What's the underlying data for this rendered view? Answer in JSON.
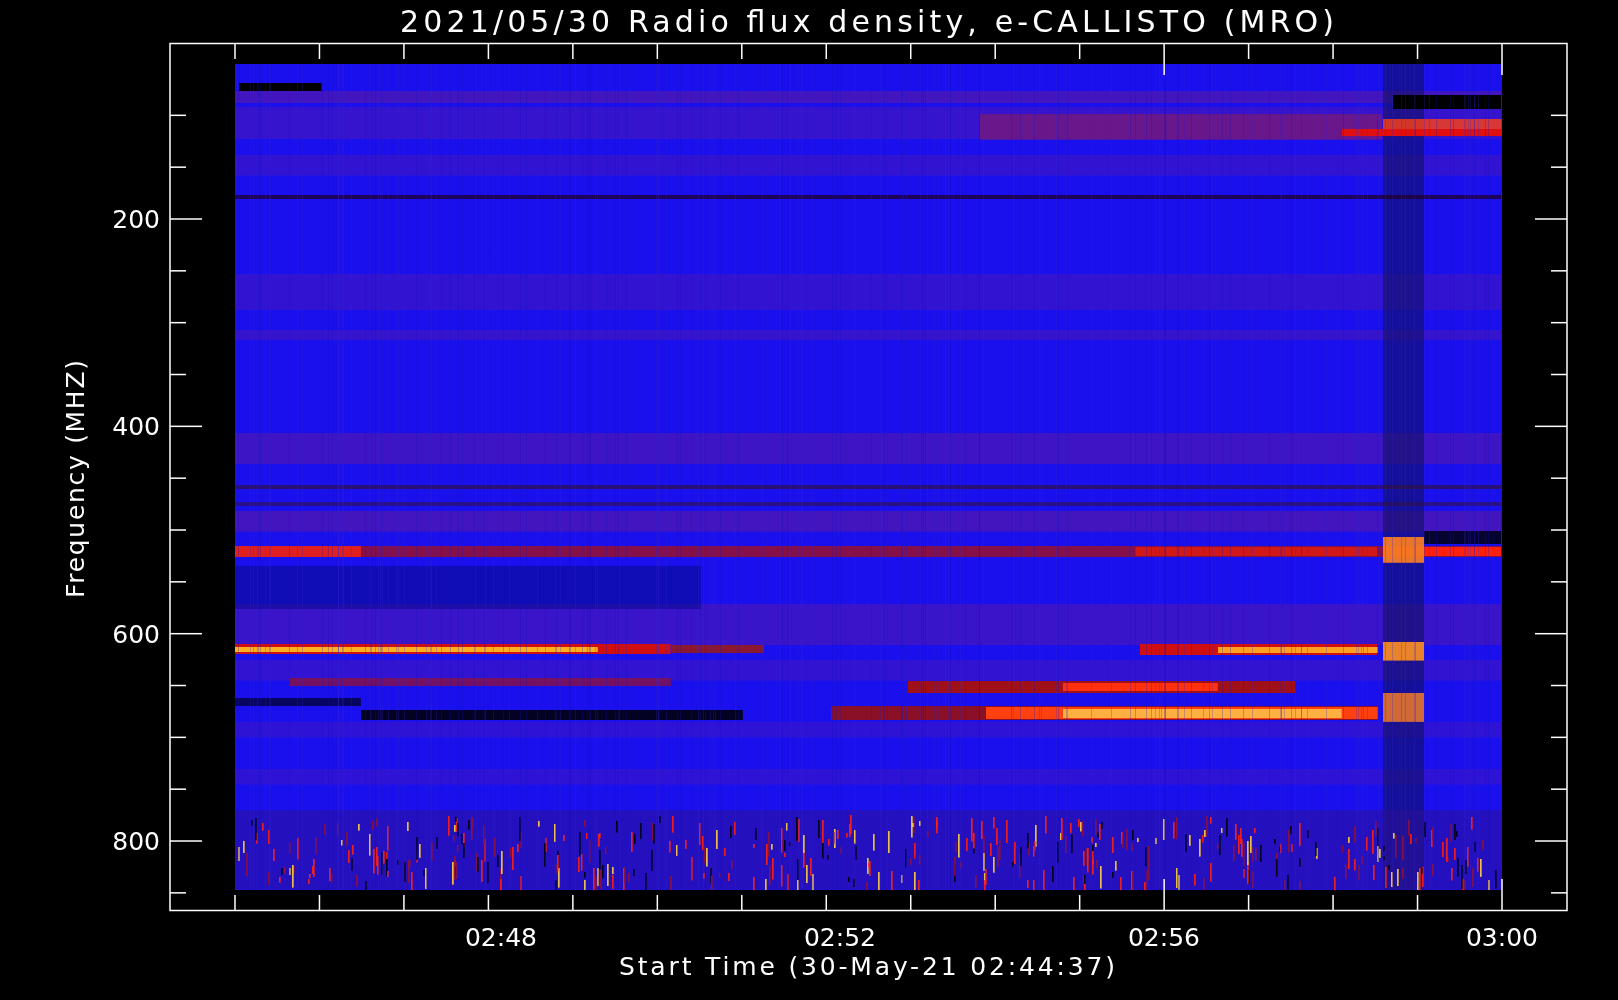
{
  "title": "2021/05/30  Radio flux density, e-CALLISTO (MRO)",
  "y_axis": {
    "label": "Frequency (MHZ)",
    "ticks": [
      "200",
      "400",
      "600",
      "800"
    ]
  },
  "x_axis": {
    "label": "Start Time (30-May-21 02:44:37)",
    "ticks": [
      "02:48",
      "02:52",
      "02:56",
      "03:00"
    ]
  }
}
